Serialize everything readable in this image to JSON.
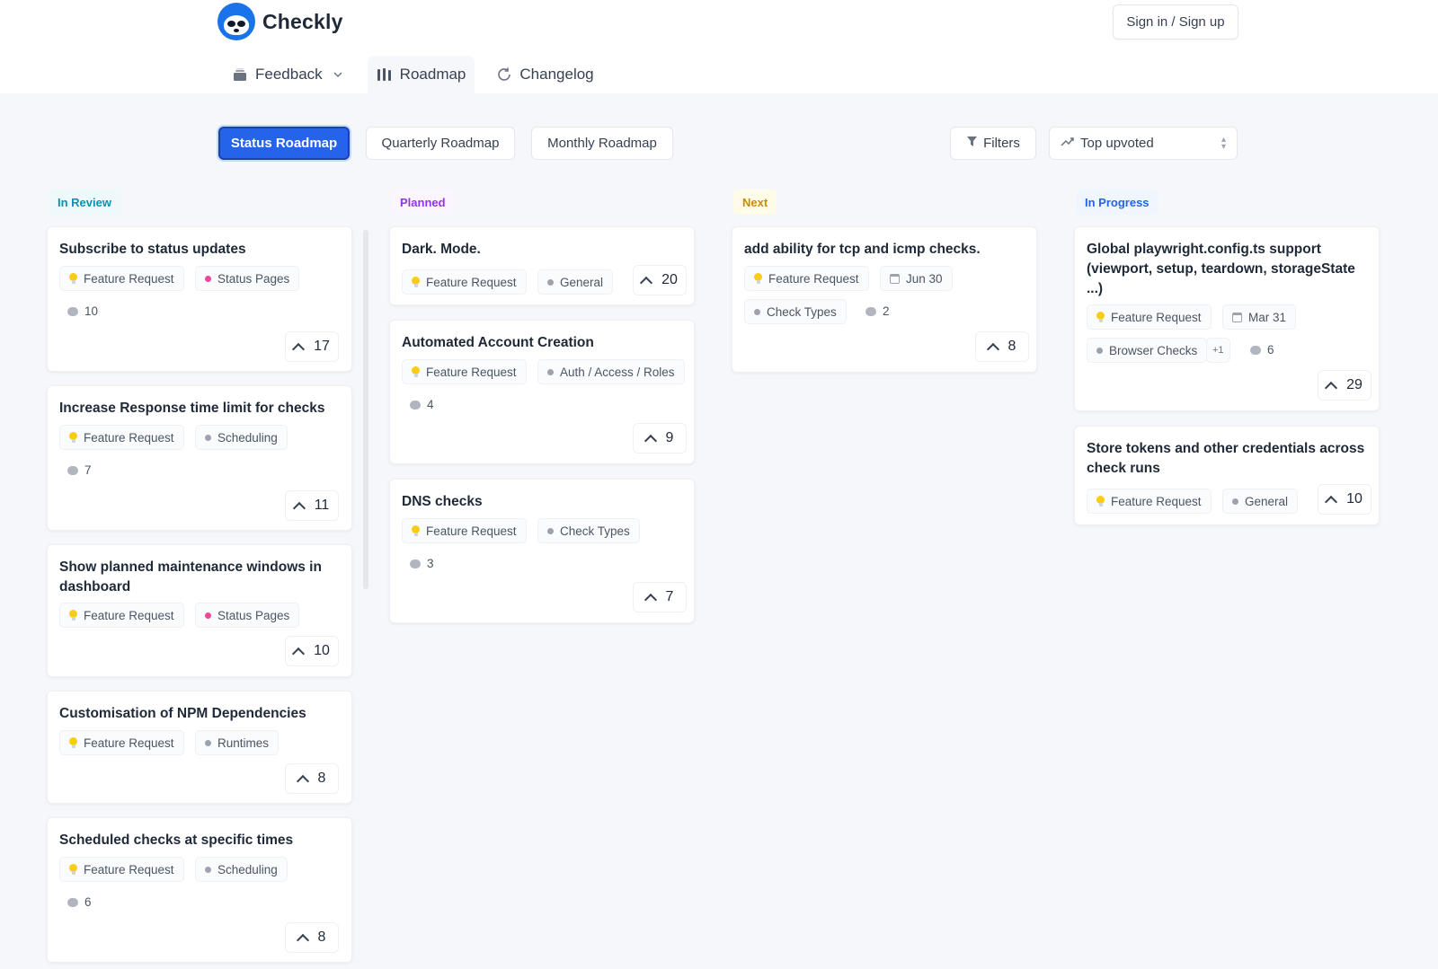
{
  "app": {
    "name": "Checkly",
    "sign_in": "Sign in / Sign up"
  },
  "nav": [
    {
      "label": "Feedback",
      "icon": "inbox-icon",
      "active": false
    },
    {
      "label": "Roadmap",
      "icon": "roadmap-icon",
      "active": true
    },
    {
      "label": "Changelog",
      "icon": "refresh-icon",
      "active": false
    }
  ],
  "toolbar": {
    "status_roadmap": "Status Roadmap",
    "quarterly_roadmap": "Quarterly Roadmap",
    "monthly_roadmap": "Monthly Roadmap",
    "filters": "Filters",
    "sort": "Top upvoted"
  },
  "colors": {
    "primary": "#2563eb",
    "in_review": "#0891b2",
    "planned": "#9333ea",
    "next": "#ca8a04",
    "in_progress": "#2563eb",
    "status_pages_dot": "#ec4899",
    "neutral_dot": "#9ca3af"
  },
  "columns": [
    {
      "name": "In Review",
      "cards": [
        {
          "title": "Subscribe to status updates",
          "type": "Feature Request",
          "category": "Status Pages",
          "comments": "10",
          "votes": "17"
        },
        {
          "title": "Increase Response time limit for checks",
          "type": "Feature Request",
          "category": "Scheduling",
          "comments": "7",
          "votes": "11"
        },
        {
          "title": "Show planned maintenance windows in dashboard",
          "type": "Feature Request",
          "category": "Status Pages",
          "votes": "10"
        },
        {
          "title": "Customisation of NPM Dependencies",
          "type": "Feature Request",
          "category": "Runtimes",
          "votes": "8"
        },
        {
          "title": "Scheduled checks at specific times",
          "type": "Feature Request",
          "category": "Scheduling",
          "comments": "6",
          "votes": "8"
        }
      ]
    },
    {
      "name": "Planned",
      "cards": [
        {
          "title": "Dark. Mode.",
          "type": "Feature Request",
          "category": "General",
          "votes": "20"
        },
        {
          "title": "Automated Account Creation",
          "type": "Feature Request",
          "category": "Auth / Access / Roles",
          "comments": "4",
          "votes": "9"
        },
        {
          "title": "DNS checks",
          "type": "Feature Request",
          "category": "Check Types",
          "comments": "3",
          "votes": "7"
        }
      ]
    },
    {
      "name": "Next",
      "cards": [
        {
          "title": "add ability for tcp and icmp checks.",
          "type": "Feature Request",
          "date": "Jun 30",
          "category": "Check Types",
          "comments": "2",
          "votes": "8"
        }
      ]
    },
    {
      "name": "In Progress",
      "cards": [
        {
          "title": "Global playwright.config.ts support (viewport, setup, teardown, storageState ...)",
          "type": "Feature Request",
          "date": "Mar 31",
          "category": "Browser Checks",
          "extra": "+1",
          "comments": "6",
          "votes": "29"
        },
        {
          "title": "Store tokens and other credentials across check runs",
          "type": "Feature Request",
          "category": "General",
          "votes": "10"
        }
      ]
    }
  ]
}
